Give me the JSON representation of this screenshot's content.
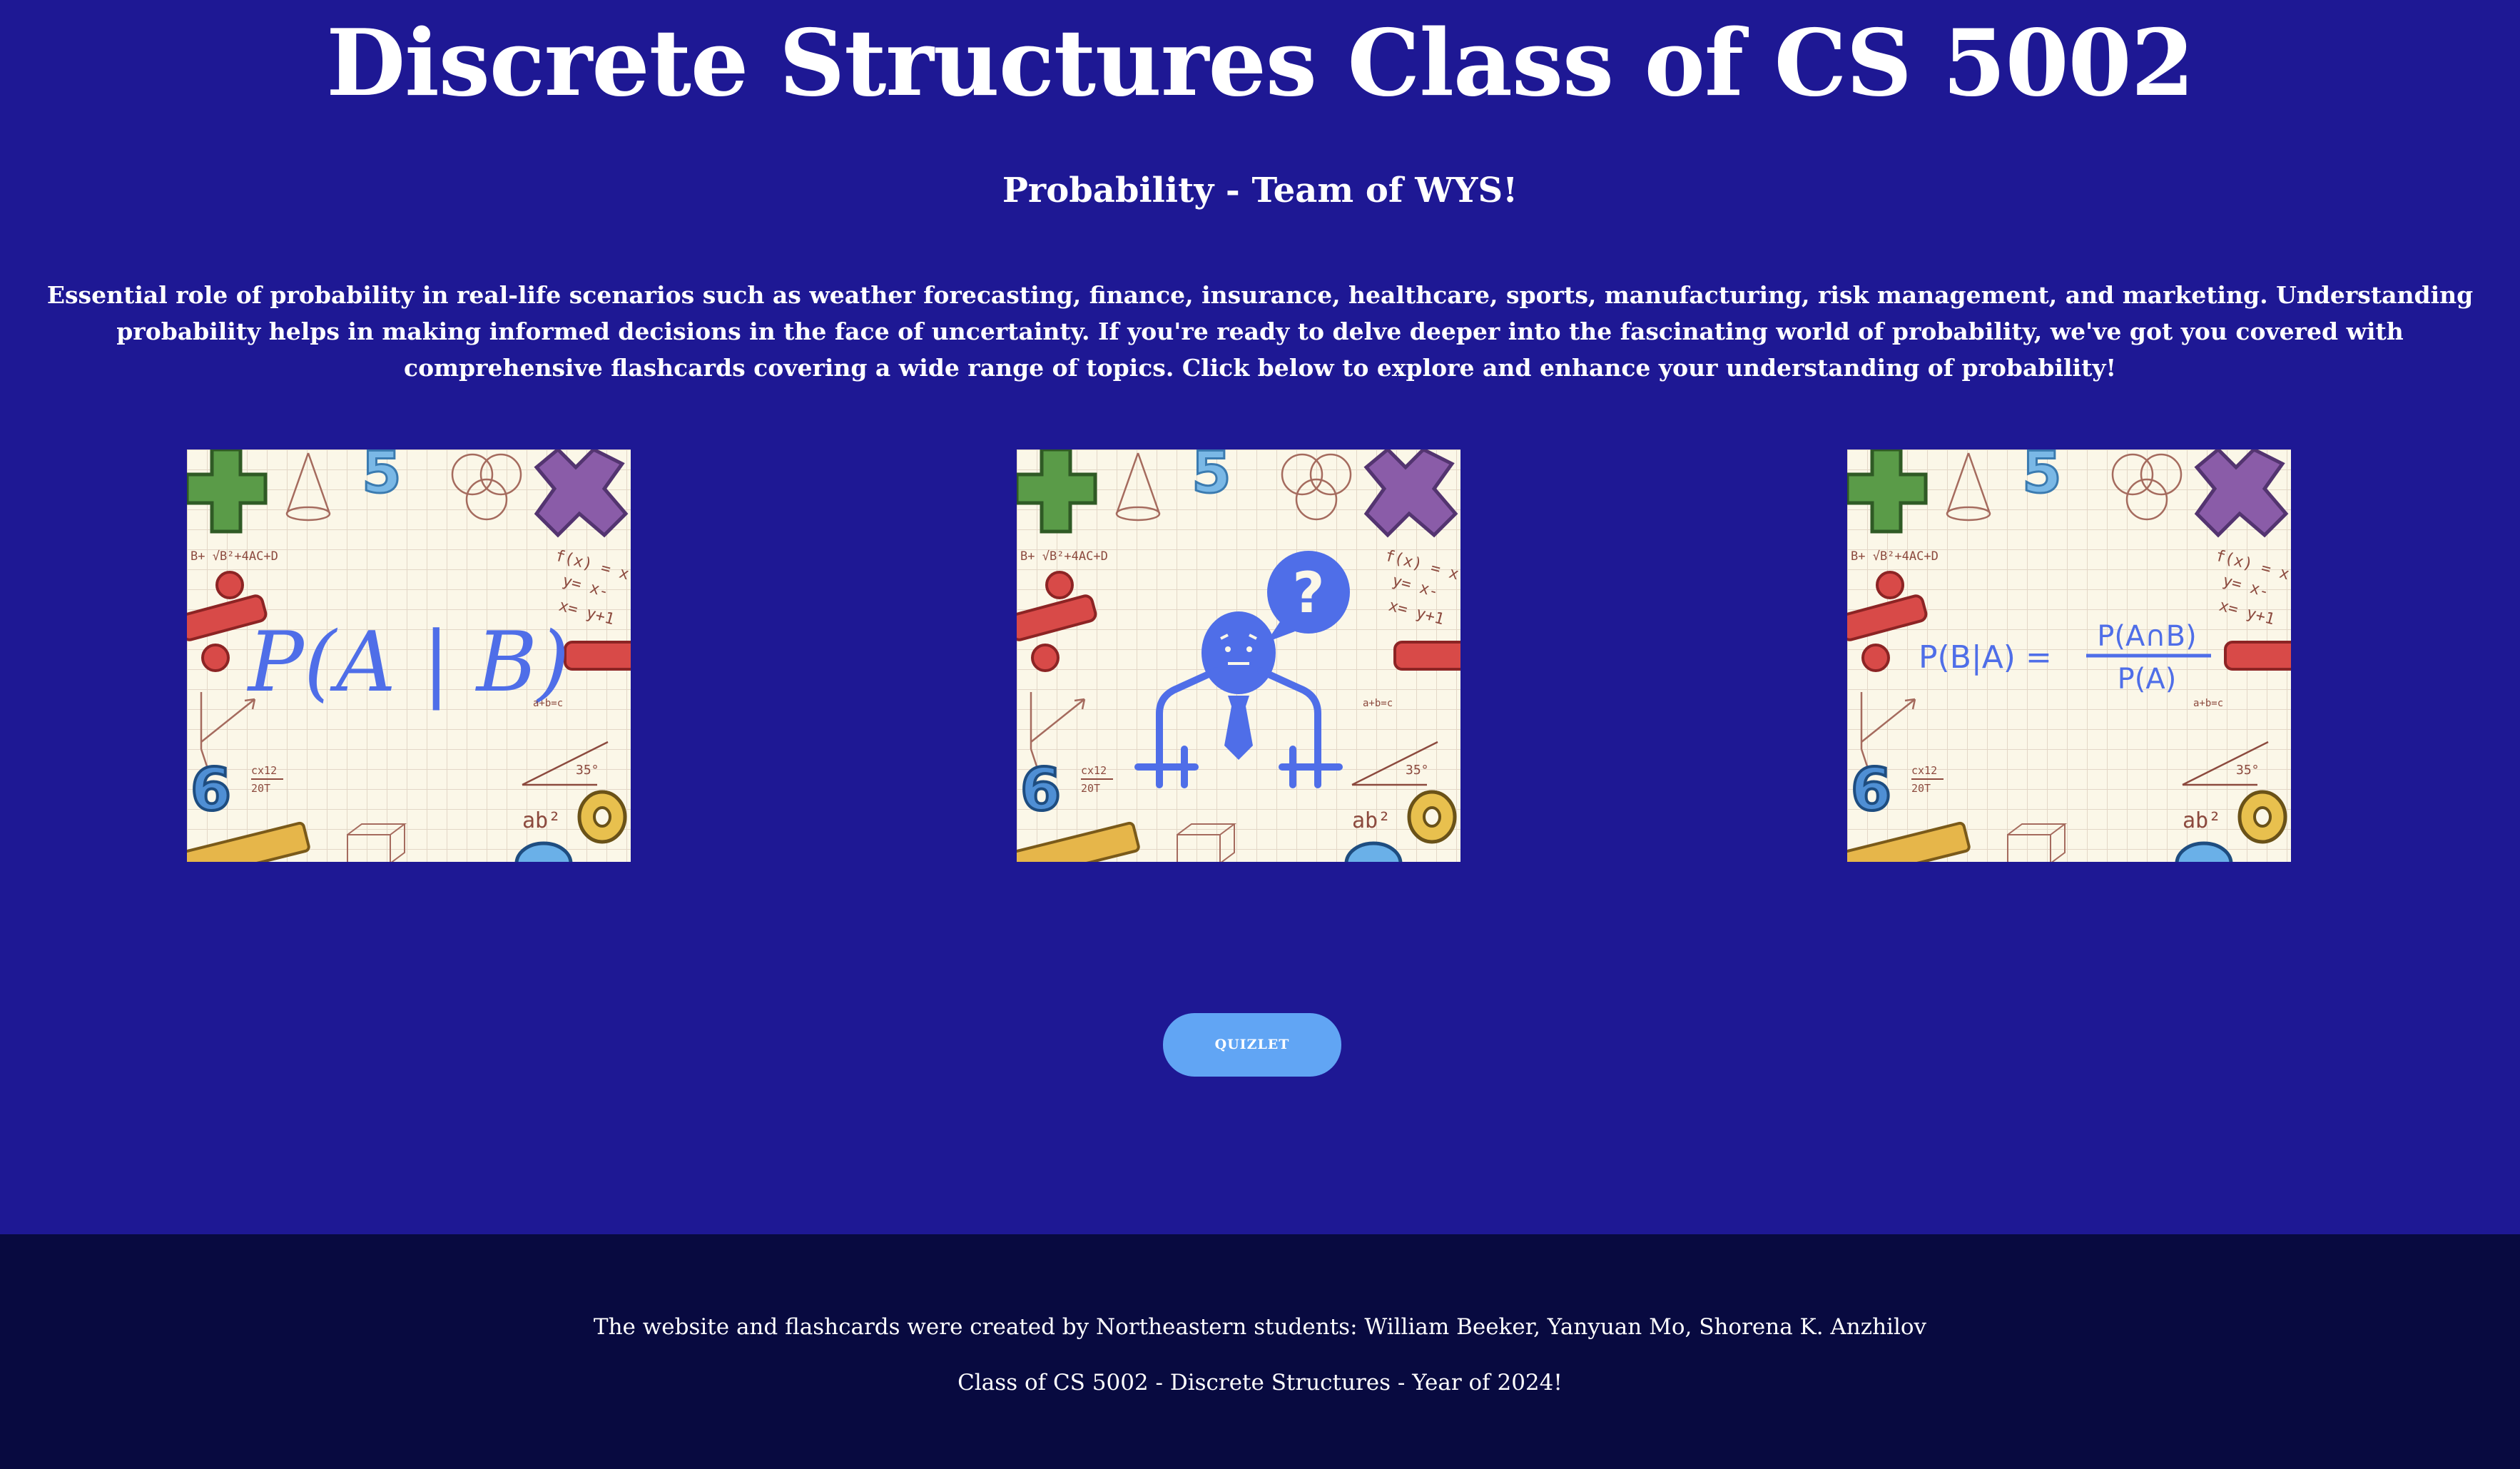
{
  "header": {
    "title": "Discrete Structures Class of CS 5002",
    "subtitle": "Probability - Team of WYS!"
  },
  "intro": {
    "text": "Essential role of probability in real-life scenarios such as weather forecasting, finance, insurance, healthcare, sports, manufacturing, risk management, and marketing. Understanding probability helps in making informed decisions in the face of uncertainty. If you're ready to delve deeper into the fascinating world of probability, we've got you covered with comprehensive flashcards covering a wide range of topics. Click below to explore and enhance your understanding of probability!"
  },
  "cards": [
    {
      "formula": "P(A | B)"
    },
    {
      "icon": "question-person-icon"
    },
    {
      "formula_left": "P(B|A) =",
      "numerator": "P(A∩B)",
      "denominator": "P(A)"
    }
  ],
  "decorations": {
    "top_formula": "B+ √B²+4AC+D",
    "fx": "f(x) = x-",
    "y1": "y= x-",
    "y2": "x= y+1",
    "frac_top": "cx12",
    "frac_bot": "20T",
    "ab": "ab²",
    "deg": "35°",
    "abc": "a+b=c"
  },
  "buttons": {
    "quizlet_label": "QUIZLET"
  },
  "footer": {
    "credits": "The website and flashcards were created by Northeastern students: William Beeker, Yanyuan Mo, Shorena K. Anzhilov",
    "class_line": "Class of CS 5002 - Discrete Structures - Year of 2024!"
  },
  "colors": {
    "page_bg": "#1e1894",
    "footer_bg": "#080a40",
    "button_bg": "#61a5f4",
    "accent_blue": "#4f6ee8",
    "card_bg": "#fbf7e8"
  }
}
